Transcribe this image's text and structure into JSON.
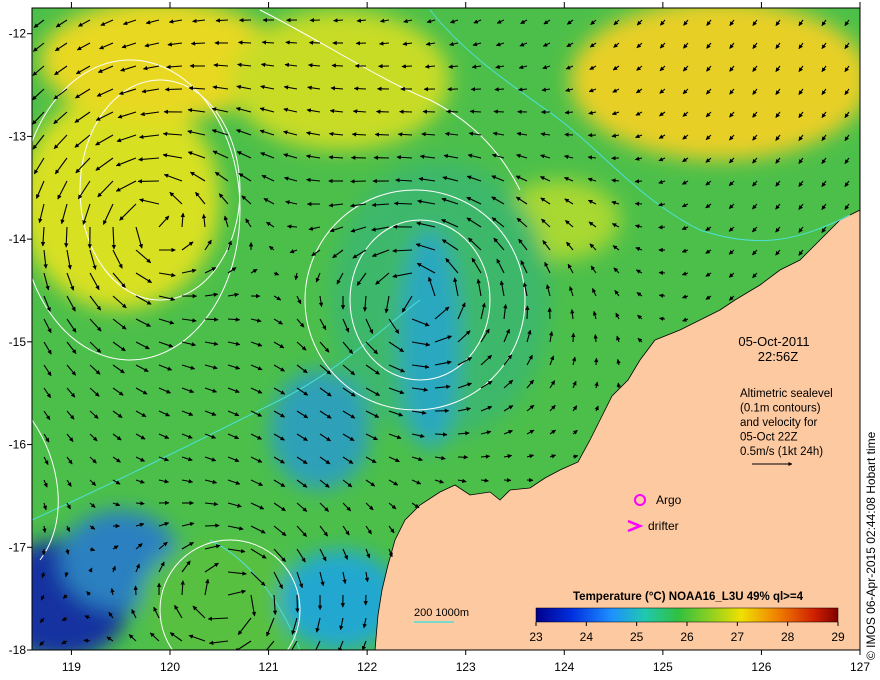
{
  "map": {
    "lon_ticks": [
      "119",
      "120",
      "121",
      "122",
      "123",
      "124",
      "125",
      "126",
      "127"
    ],
    "lat_ticks": [
      "-12",
      "-13",
      "-14",
      "-15",
      "-16",
      "-17",
      "-18"
    ],
    "lon_range": [
      118.6,
      127.0
    ],
    "lat_range": [
      -18.0,
      -11.75
    ],
    "land_color": "#fcc9a0",
    "contour_color": "#ffffff",
    "isobath_color": "#4de0d8"
  },
  "annotation": {
    "date": "05-Oct-2011",
    "time": "22:56Z",
    "info_lines": [
      "Altimetric sealevel",
      "(0.1m contours)",
      "and velocity for",
      "05-Oct 22Z",
      "0.5m/s (1kt 24h)"
    ]
  },
  "legend": {
    "argo_label": "Argo",
    "drifter_label": "drifter",
    "marker_color": "#ff00ff",
    "isobath_label": "200  1000m"
  },
  "colorbar": {
    "title": "Temperature (°C) NOAA16_L3U 49% ql>=4",
    "tick_labels": [
      "23",
      "24",
      "25",
      "26",
      "27",
      "28",
      "29"
    ],
    "range": [
      23,
      29
    ]
  },
  "credit": "© IMOS 06-Apr-2015 02:44:08 Hobart time"
}
